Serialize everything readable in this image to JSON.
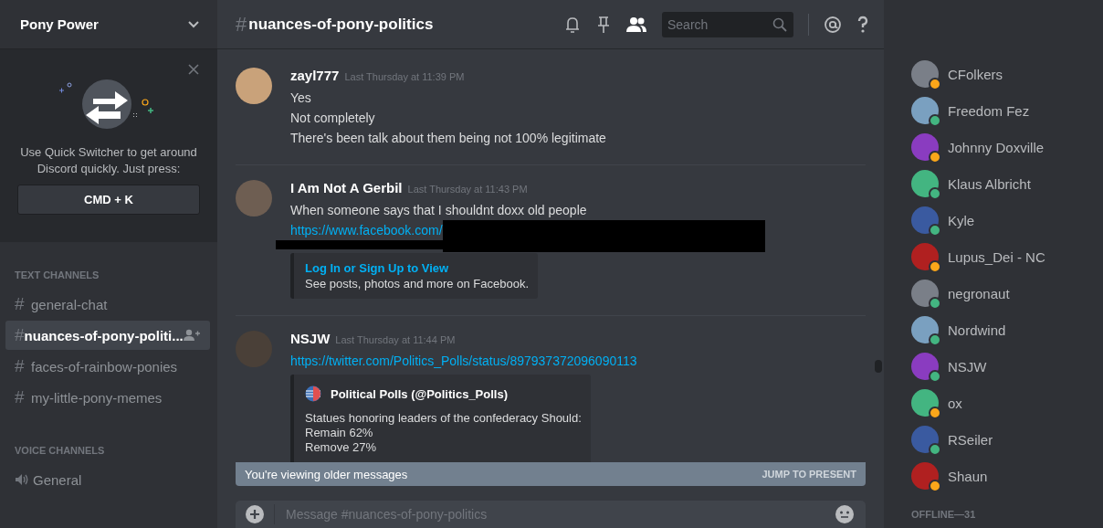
{
  "server": {
    "name": "Pony Power"
  },
  "quick_switcher": {
    "text": "Use Quick Switcher to get around Discord quickly. Just press:",
    "shortcut": "CMD + K"
  },
  "channel_groups": [
    {
      "title": "TEXT CHANNELS",
      "channels": [
        {
          "kind": "text",
          "prefix": "#",
          "name": "general-chat",
          "selected": false
        },
        {
          "kind": "text",
          "prefix": "#",
          "name": "nuances-of-pony-politi...",
          "selected": true
        },
        {
          "kind": "text",
          "prefix": "#",
          "name": "faces-of-rainbow-ponies",
          "selected": false
        },
        {
          "kind": "text",
          "prefix": "#",
          "name": "my-little-pony-memes",
          "selected": false
        }
      ]
    },
    {
      "title": "VOICE CHANNELS",
      "channels": [
        {
          "kind": "voice",
          "name": "General",
          "selected": false
        }
      ]
    }
  ],
  "header": {
    "hash": "#",
    "channel": "nuances-of-pony-politics",
    "search": {
      "placeholder": "Search"
    }
  },
  "messages": [
    {
      "author": "zayl777",
      "time": "Last Thursday at 11:39 PM",
      "lines": [
        {
          "kind": "text",
          "text": "Yes"
        },
        {
          "kind": "text",
          "text": "Not completely"
        },
        {
          "kind": "text",
          "text": "There's been talk about them being not 100% legitimate"
        }
      ]
    },
    {
      "author": "I Am Not A Gerbil",
      "time": "Last Thursday at 11:43 PM",
      "lines": [
        {
          "kind": "text",
          "text": "When someone says that I shouldnt doxx old people"
        },
        {
          "kind": "redacted_link",
          "text": "https://www.facebook.com/"
        },
        {
          "kind": "embed",
          "title": "Log In or Sign Up to View",
          "description": "See posts, photos and more on Facebook."
        }
      ]
    },
    {
      "author": "NSJW",
      "time": "Last Thursday at 11:44 PM",
      "lines": [
        {
          "kind": "link",
          "text": "https://twitter.com/Politics_Polls/status/897937372096090113"
        },
        {
          "kind": "tweet",
          "title": "Political Polls (@Politics_Polls)",
          "body": [
            "Statues honoring leaders of the confederacy Should:",
            "Remain 62%",
            "Remove 27%"
          ]
        }
      ]
    }
  ],
  "older_banner": {
    "text": "You're viewing older messages",
    "action": "JUMP TO PRESENT"
  },
  "composer": {
    "placeholder": "Message #nuances-of-pony-politics"
  },
  "members": [
    {
      "name": "CFolkers",
      "color": "#faa61a"
    },
    {
      "name": "Freedom Fez",
      "color": "#43b581"
    },
    {
      "name": "Johnny Doxville",
      "color": "#faa61a"
    },
    {
      "name": "Klaus Albricht",
      "color": "#43b581"
    },
    {
      "name": "Kyle",
      "color": "#43b581"
    },
    {
      "name": "Lupus_Dei - NC",
      "color": "#faa61a"
    },
    {
      "name": "negronaut",
      "color": "#43b581"
    },
    {
      "name": "Nordwind",
      "color": "#43b581"
    },
    {
      "name": "NSJW",
      "color": "#43b581"
    },
    {
      "name": "ox",
      "color": "#faa61a"
    },
    {
      "name": "RSeiler",
      "color": "#43b581"
    },
    {
      "name": "Shaun",
      "color": "#faa61a"
    }
  ],
  "offline_heading": "OFFLINE—31"
}
